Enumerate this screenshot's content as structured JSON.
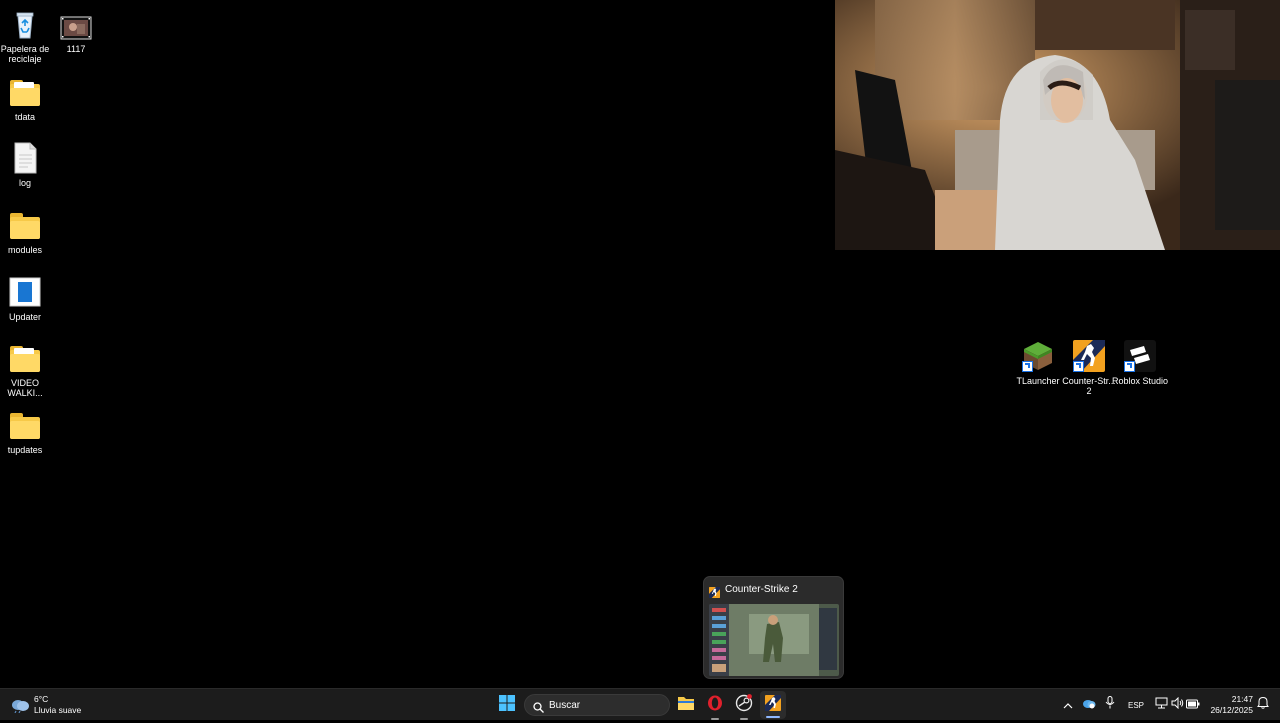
{
  "desktop": {
    "left_icons": [
      {
        "label": "Papelera de reciclaje",
        "icon": "recycle-bin-icon"
      },
      {
        "label": "1117",
        "icon": "video-file-icon"
      },
      {
        "label": "tdata",
        "icon": "folder-icon"
      },
      {
        "label": "log",
        "icon": "text-file-icon"
      },
      {
        "label": "modules",
        "icon": "folder-icon"
      },
      {
        "label": "Updater",
        "icon": "updater-app-icon"
      },
      {
        "label": "VIDEO WALKI...",
        "icon": "folder-icon"
      },
      {
        "label": "tupdates",
        "icon": "folder-icon"
      }
    ],
    "right_icons": [
      {
        "label": "TLauncher",
        "icon": "tlauncher-icon"
      },
      {
        "label": "Counter-Str... 2",
        "icon": "counter-strike-icon"
      },
      {
        "label": "Roblox Studio",
        "icon": "roblox-studio-icon"
      }
    ]
  },
  "preview": {
    "title": "Counter-Strike 2",
    "icon": "counter-strike-icon"
  },
  "taskbar": {
    "weather": {
      "temp": "6°C",
      "condition": "Lluvia suave",
      "icon": "cloud-rain-icon"
    },
    "search_placeholder": "Buscar",
    "apps": [
      {
        "name": "start",
        "icon": "windows-start-icon"
      },
      {
        "name": "file-explorer",
        "icon": "folder-icon"
      },
      {
        "name": "opera",
        "icon": "opera-icon"
      },
      {
        "name": "steam",
        "icon": "steam-icon"
      },
      {
        "name": "counter-strike-2",
        "icon": "counter-strike-icon"
      }
    ],
    "tray": {
      "language": "ESP",
      "time": "21:47",
      "date": "26/12/2025"
    }
  },
  "colors": {
    "desktop_bg": "#000000",
    "taskbar_bg": "#1c1c1c",
    "folder_yellow": "#f7c948",
    "accent": "#8fb8ff"
  }
}
